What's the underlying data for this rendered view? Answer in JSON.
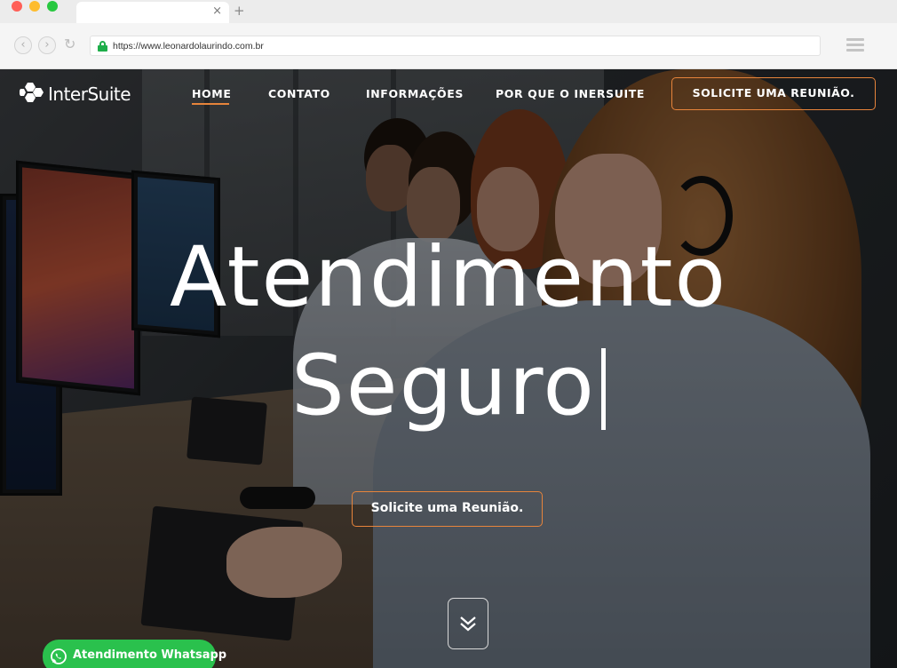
{
  "browser": {
    "url": "https://www.leonardolaurindo.com.br",
    "tab_close_glyph": "×",
    "new_tab_glyph": "+",
    "back_glyph": "‹",
    "forward_glyph": "›",
    "reload_glyph": "↻"
  },
  "site": {
    "brand": "InterSuite",
    "nav": {
      "home": "HOME",
      "contato": "CONTATO",
      "informacoes": "INFORMAÇÕES",
      "porque": "POR QUE O INERSUITE",
      "cta": "SOLICITE UMA REUNIÃO."
    },
    "accent_color": "#e7843b"
  },
  "hero": {
    "headline_line1": "Atendimento",
    "headline_line2": "Seguro",
    "cta": "Solicite uma Reunião.",
    "scroll_icon": "double-chevron-down-icon"
  },
  "whatsapp": {
    "label": "Atendimento Whatsapp",
    "icon": "whatsapp-icon",
    "color": "#2ac14d"
  }
}
